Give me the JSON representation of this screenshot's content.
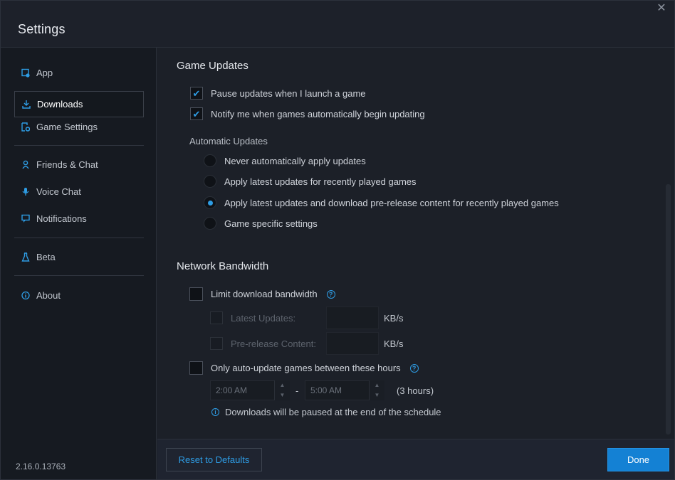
{
  "window": {
    "title": "Settings",
    "close_glyph": "✕"
  },
  "sidebar": {
    "items": [
      {
        "label": "App",
        "icon": "app-icon"
      },
      {
        "label": "Downloads",
        "icon": "download-icon",
        "active": true
      },
      {
        "label": "Game Settings",
        "icon": "game-settings-icon"
      },
      {
        "label": "Friends & Chat",
        "icon": "friends-icon"
      },
      {
        "label": "Voice Chat",
        "icon": "microphone-icon"
      },
      {
        "label": "Notifications",
        "icon": "notification-icon"
      },
      {
        "label": "Beta",
        "icon": "flask-icon"
      },
      {
        "label": "About",
        "icon": "info-icon"
      }
    ],
    "version": "2.16.0.13763"
  },
  "game_updates": {
    "title": "Game Updates",
    "pause_label": "Pause updates when I launch a game",
    "pause_checked": true,
    "notify_label": "Notify me when games automatically begin updating",
    "notify_checked": true,
    "auto_updates_label": "Automatic Updates",
    "options": [
      {
        "label": "Never automatically apply updates",
        "selected": false
      },
      {
        "label": "Apply latest updates for recently played games",
        "selected": false
      },
      {
        "label": "Apply latest updates and download pre-release content for recently played games",
        "selected": true
      },
      {
        "label": "Game specific settings",
        "selected": false
      }
    ]
  },
  "network": {
    "title": "Network Bandwidth",
    "limit_label": "Limit download bandwidth",
    "limit_checked": false,
    "latest_label": "Latest Updates:",
    "latest_value": "",
    "prerelease_label": "Pre-release Content:",
    "prerelease_value": "",
    "unit": "KB/s",
    "schedule_label": "Only auto-update games between these hours",
    "schedule_checked": false,
    "start_time": "2:00 AM",
    "end_time": "5:00 AM",
    "separator": "-",
    "duration": "(3 hours)",
    "info_text": "Downloads will be paused at the end of the schedule",
    "help_glyph": "?",
    "info_glyph": "i"
  },
  "footer": {
    "reset_label": "Reset to Defaults",
    "done_label": "Done"
  },
  "colors": {
    "accent": "#2e9de5",
    "done_button": "#1481d4",
    "background": "#1c2028",
    "sidebar": "#161a21"
  }
}
